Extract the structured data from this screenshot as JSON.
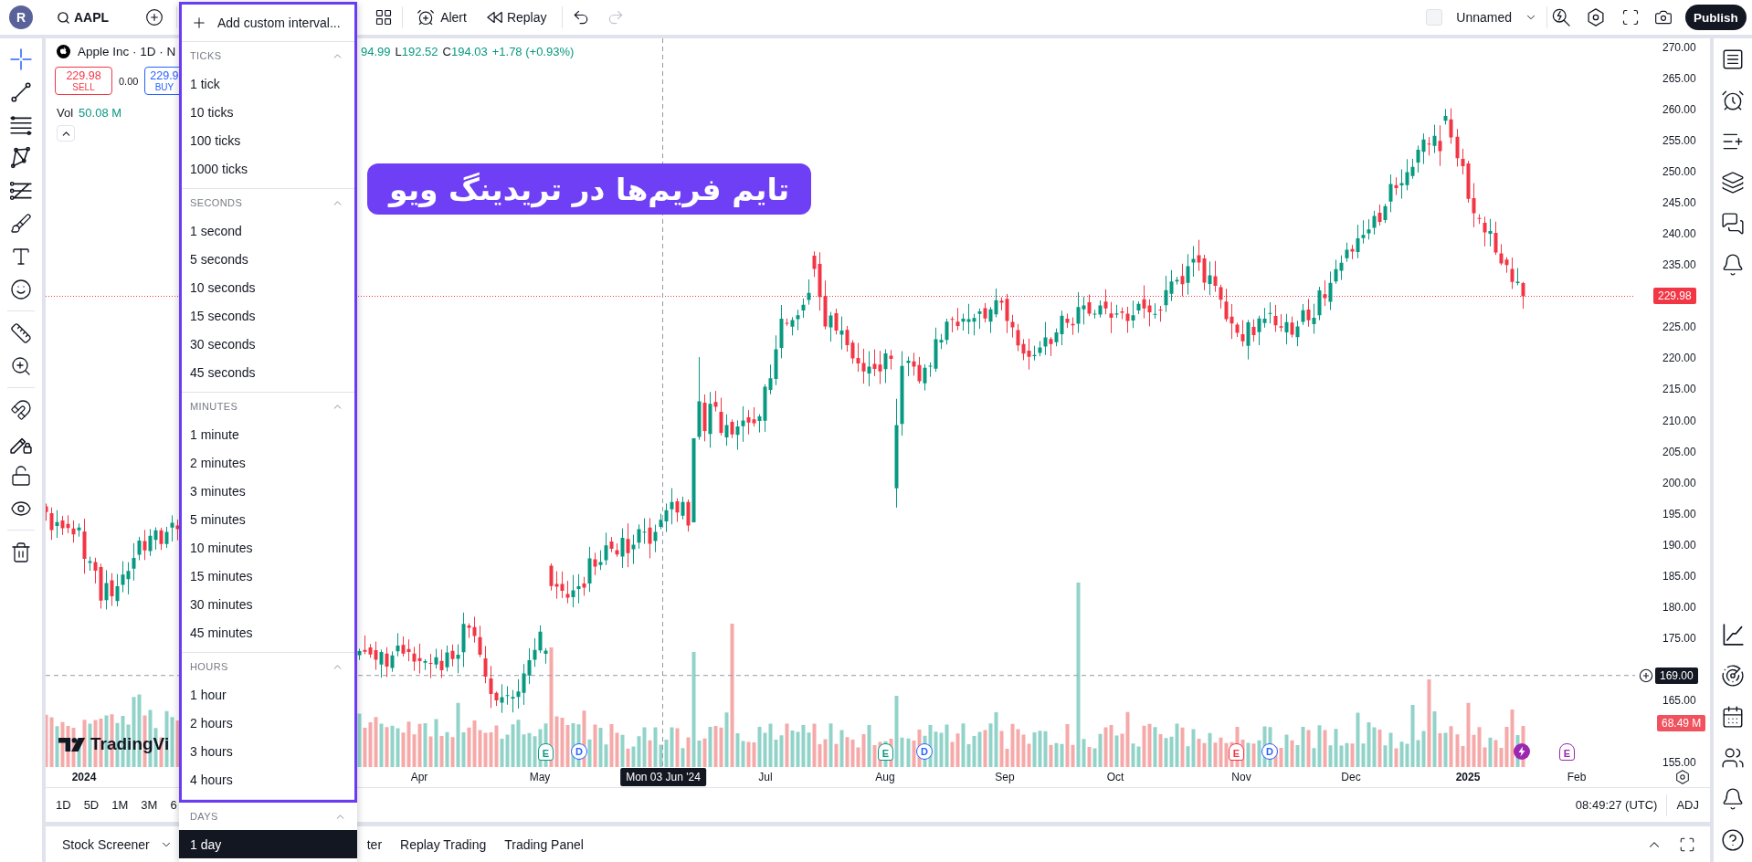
{
  "top_bar": {
    "avatar": "R",
    "symbol": "AAPL",
    "alert": "Alert",
    "replay": "Replay",
    "undo_disabled": false,
    "redo_disabled": true,
    "layout_name": "Unnamed",
    "publish": "Publish"
  },
  "interval_menu": {
    "add_custom": "Add custom interval...",
    "sections": [
      {
        "title": "TICKS",
        "expanded": true,
        "highlighted": true,
        "items": [
          {
            "label": "1 tick",
            "selected": false
          },
          {
            "label": "10 ticks",
            "selected": false
          },
          {
            "label": "100 ticks",
            "selected": false
          },
          {
            "label": "1000 ticks",
            "selected": false
          }
        ]
      },
      {
        "title": "SECONDS",
        "expanded": true,
        "highlighted": true,
        "items": [
          {
            "label": "1 second",
            "selected": false
          },
          {
            "label": "5 seconds",
            "selected": false
          },
          {
            "label": "10 seconds",
            "selected": false
          },
          {
            "label": "15 seconds",
            "selected": false
          },
          {
            "label": "30 seconds",
            "selected": false
          },
          {
            "label": "45 seconds",
            "selected": false
          }
        ]
      },
      {
        "title": "MINUTES",
        "expanded": true,
        "highlighted": true,
        "items": [
          {
            "label": "1 minute",
            "selected": false
          },
          {
            "label": "2 minutes",
            "selected": false
          },
          {
            "label": "3 minutes",
            "selected": false
          },
          {
            "label": "5 minutes",
            "selected": false
          },
          {
            "label": "10 minutes",
            "selected": false
          },
          {
            "label": "15 minutes",
            "selected": false
          },
          {
            "label": "30 minutes",
            "selected": false
          },
          {
            "label": "45 minutes",
            "selected": false
          }
        ]
      },
      {
        "title": "HOURS",
        "expanded": true,
        "highlighted": true,
        "items": [
          {
            "label": "1 hour",
            "selected": false
          },
          {
            "label": "2 hours",
            "selected": false
          },
          {
            "label": "3 hours",
            "selected": false
          },
          {
            "label": "4 hours",
            "selected": false
          }
        ]
      },
      {
        "title": "DAYS",
        "expanded": true,
        "highlighted": false,
        "items": [
          {
            "label": "1 day",
            "selected": true
          }
        ]
      }
    ]
  },
  "left_toolbar": {
    "groups": [
      {
        "tools": [
          {
            "kind": "crosshair",
            "selected": true
          },
          {
            "kind": "trend-line",
            "selected": false
          },
          {
            "kind": "horizontal-lines",
            "selected": false
          },
          {
            "kind": "pattern",
            "selected": false
          },
          {
            "kind": "fib-channel",
            "selected": false
          },
          {
            "kind": "brush",
            "selected": false
          },
          {
            "kind": "text",
            "selected": false
          },
          {
            "kind": "emoji",
            "selected": false
          }
        ]
      },
      {
        "tools": [
          {
            "kind": "ruler",
            "selected": false
          },
          {
            "kind": "zoom",
            "selected": false
          }
        ]
      },
      {
        "tools": [
          {
            "kind": "magnet",
            "selected": false
          },
          {
            "kind": "pencil-lock",
            "selected": false
          },
          {
            "kind": "lock",
            "selected": false
          },
          {
            "kind": "eye",
            "selected": false
          }
        ]
      },
      {
        "tools": [
          {
            "kind": "trash",
            "selected": false
          }
        ]
      }
    ]
  },
  "legend": {
    "title": "Apple Inc · 1D · N",
    "rising": true,
    "ohlc": [
      {
        "value": "94.99"
      },
      {
        "label": "L",
        "value": "192.52"
      },
      {
        "label": "C",
        "value": "194.03"
      }
    ],
    "change": "+1.78 (+0.93%)",
    "sell": {
      "price": "229.98",
      "label": "SELL"
    },
    "spread": "0.00",
    "buy": {
      "price": "229.9",
      "label": "BUY"
    },
    "volume": {
      "label": "Vol",
      "value": "50.08 M"
    }
  },
  "banner": {
    "text": "تایم فریم‌ها در تریدینگ ویو"
  },
  "chart_logo": "TradingVi",
  "events": [
    {
      "kind": "earnings",
      "label": "E",
      "color": "#089981"
    },
    {
      "kind": "dividend",
      "label": "D",
      "color": "#2962ff"
    },
    {
      "kind": "earnings",
      "label": "E",
      "color": "#089981"
    },
    {
      "kind": "dividend",
      "label": "D",
      "color": "#2962ff"
    },
    {
      "kind": "earnings",
      "label": "E",
      "color": "#f23645"
    },
    {
      "kind": "dividend",
      "label": "D",
      "color": "#2962ff"
    },
    {
      "kind": "flash",
      "color": "#9c27b0"
    },
    {
      "kind": "earnings",
      "label": "E",
      "color": "#9c27b0"
    }
  ],
  "price_axis": {
    "labels": [
      "270.00",
      "265.00",
      "260.00",
      "255.00",
      "250.00",
      "245.00",
      "240.00",
      "235.00",
      "225.00",
      "220.00",
      "215.00",
      "210.00",
      "205.00",
      "200.00",
      "195.00",
      "190.00",
      "185.00",
      "180.00",
      "175.00",
      "165.00",
      "155.00"
    ],
    "last_price": "229.98",
    "crosshair_price": "169.00",
    "volume_value": "68.49 M"
  },
  "time_axis": {
    "labels": [
      {
        "text": "2024",
        "kind": "year"
      },
      {
        "text": "Apr",
        "kind": "month"
      },
      {
        "text": "May",
        "kind": "month"
      },
      {
        "text": "Jul",
        "kind": "month"
      },
      {
        "text": "Aug",
        "kind": "month"
      },
      {
        "text": "Sep",
        "kind": "month"
      },
      {
        "text": "Oct",
        "kind": "month"
      },
      {
        "text": "Nov",
        "kind": "month"
      },
      {
        "text": "Dec",
        "kind": "month"
      },
      {
        "text": "2025",
        "kind": "year"
      },
      {
        "text": "Feb",
        "kind": "month"
      }
    ],
    "crosshair_date": "Mon 03 Jun '24"
  },
  "range_bar": {
    "ranges": [
      "1D",
      "5D",
      "1M",
      "3M",
      "6"
    ],
    "timezone": "08:49:27 (UTC)",
    "adjustment": "ADJ"
  },
  "bottom_panel": {
    "tabs": [
      {
        "label": "Stock Screener",
        "kind": "dropdown"
      },
      {
        "label": "ter",
        "kind": "tab"
      },
      {
        "label": "Replay Trading",
        "kind": "tab"
      },
      {
        "label": "Trading Panel",
        "kind": "tab"
      }
    ]
  }
}
